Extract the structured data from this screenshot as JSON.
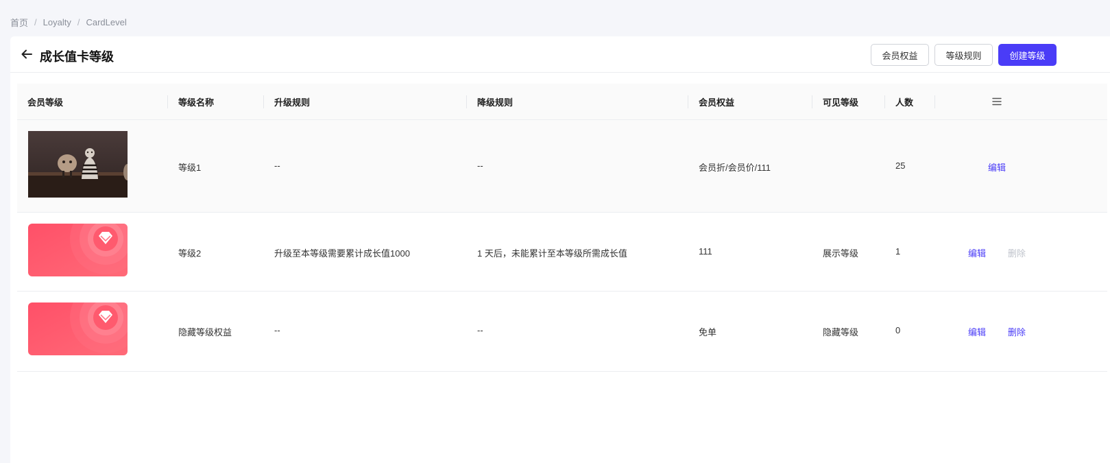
{
  "breadcrumb": [
    "首页",
    "Loyalty",
    "CardLevel"
  ],
  "breadcrumb_sep": "/",
  "header": {
    "title": "成长值卡等级",
    "buttons": {
      "benefits": "会员权益",
      "rules": "等级规则",
      "create": "创建等级"
    }
  },
  "colors": {
    "primary": "#4a3cf7",
    "card_red": "#ff5a6e",
    "link_disabled": "#c0c4cc"
  },
  "table": {
    "columns": [
      "会员等级",
      "等级名称",
      "升级规则",
      "降级规则",
      "会员权益",
      "可见等级",
      "人数"
    ],
    "column_menu_icon": "menu-icon",
    "rows": [
      {
        "thumb": "photo-figurines",
        "name": "等级1",
        "upgrade": "--",
        "downgrade": "--",
        "benefits": "会员折/会员价/111",
        "visibility": "",
        "count": "25",
        "edit": "编辑",
        "delete": ""
      },
      {
        "thumb": "red-diamond-card",
        "name": "等级2",
        "upgrade": "升级至本等级需要累计成长值1000",
        "downgrade": "1 天后，未能累计至本等级所需成长值",
        "benefits": "111",
        "visibility": "展示等级",
        "count": "1",
        "edit": "编辑",
        "delete": "删除",
        "delete_disabled": true
      },
      {
        "thumb": "red-diamond-card",
        "name": "隐藏等级权益",
        "upgrade": "--",
        "downgrade": "--",
        "benefits": "免单",
        "visibility": "隐藏等级",
        "count": "0",
        "edit": "编辑",
        "delete": "删除",
        "delete_disabled": false
      }
    ]
  }
}
